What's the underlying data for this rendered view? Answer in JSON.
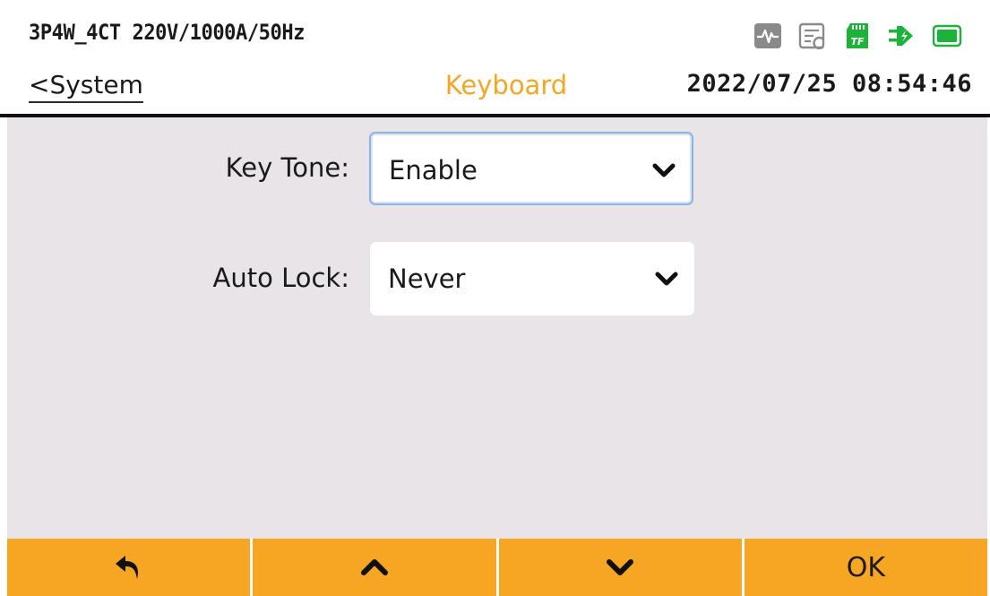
{
  "header": {
    "wiring_config": "3P4W_4CT 220V/1000A/50Hz",
    "back_label": "<System",
    "title": "Keyboard",
    "datetime": "2022/07/25 08:54:46",
    "status_icons": [
      "waveform-icon",
      "record-log-icon",
      "tf-card-icon",
      "power-plug-icon",
      "battery-icon"
    ],
    "tf_label": "TF"
  },
  "settings": {
    "key_tone": {
      "label": "Key Tone:",
      "value": "Enable"
    },
    "auto_lock": {
      "label": "Auto Lock:",
      "value": "Never"
    }
  },
  "softkeys": {
    "ok_label": "OK",
    "icons": [
      "return-icon",
      "up-icon",
      "down-icon"
    ]
  },
  "colors": {
    "accent": "#f6a623",
    "title": "#f5a623",
    "content_bg": "#e8e4e8",
    "status_green": "#1db33a",
    "status_gray": "#8a8a8a"
  }
}
